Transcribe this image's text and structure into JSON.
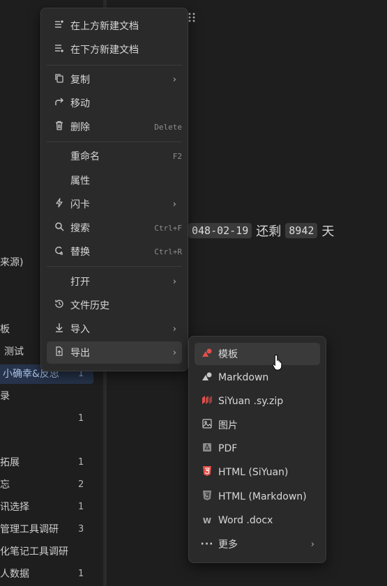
{
  "sidebar": {
    "rows": [
      {
        "label": "来源)",
        "count": ""
      },
      {
        "label": "板",
        "count": ""
      },
      {
        "label": "测试",
        "count": ""
      },
      {
        "label": "小确幸&反思",
        "count": "1"
      },
      {
        "label": "录",
        "count": ""
      },
      {
        "label": "",
        "count": "1"
      },
      {
        "label": "拓展",
        "count": "1"
      },
      {
        "label": "忘",
        "count": "2"
      },
      {
        "label": "讯选择",
        "count": "1"
      },
      {
        "label": "管理工具调研",
        "count": "3"
      },
      {
        "label": "化笔记工具调研",
        "count": ""
      },
      {
        "label": "人数据",
        "count": "1"
      }
    ]
  },
  "editor": {
    "date_chip": "048-02-19",
    "word_remaining": "还剩",
    "days_chip": "8942",
    "word_day": "天"
  },
  "context_menu": {
    "new_above": "在上方新建文档",
    "new_below": "在下方新建文档",
    "copy": "复制",
    "move": "移动",
    "delete": "删除",
    "delete_shortcut": "Delete",
    "rename": "重命名",
    "rename_shortcut": "F2",
    "attributes": "属性",
    "flashcard": "闪卡",
    "search": "搜索",
    "search_shortcut": "Ctrl+F",
    "replace": "替换",
    "replace_shortcut": "Ctrl+R",
    "open": "打开",
    "file_history": "文件历史",
    "import": "导入",
    "export": "导出"
  },
  "export_menu": {
    "template": "模板",
    "markdown": "Markdown",
    "siyuan_zip": "SiYuan .sy.zip",
    "image": "图片",
    "pdf": "PDF",
    "html_siyuan": "HTML (SiYuan)",
    "html_markdown": "HTML (Markdown)",
    "word": "Word .docx",
    "more": "更多"
  },
  "colors": {
    "background": "#1e1e1e",
    "menu": "#2a2a2a",
    "highlight": "#3a3a3a",
    "accent_red": "#e2504a",
    "active_row": "#26334a"
  }
}
